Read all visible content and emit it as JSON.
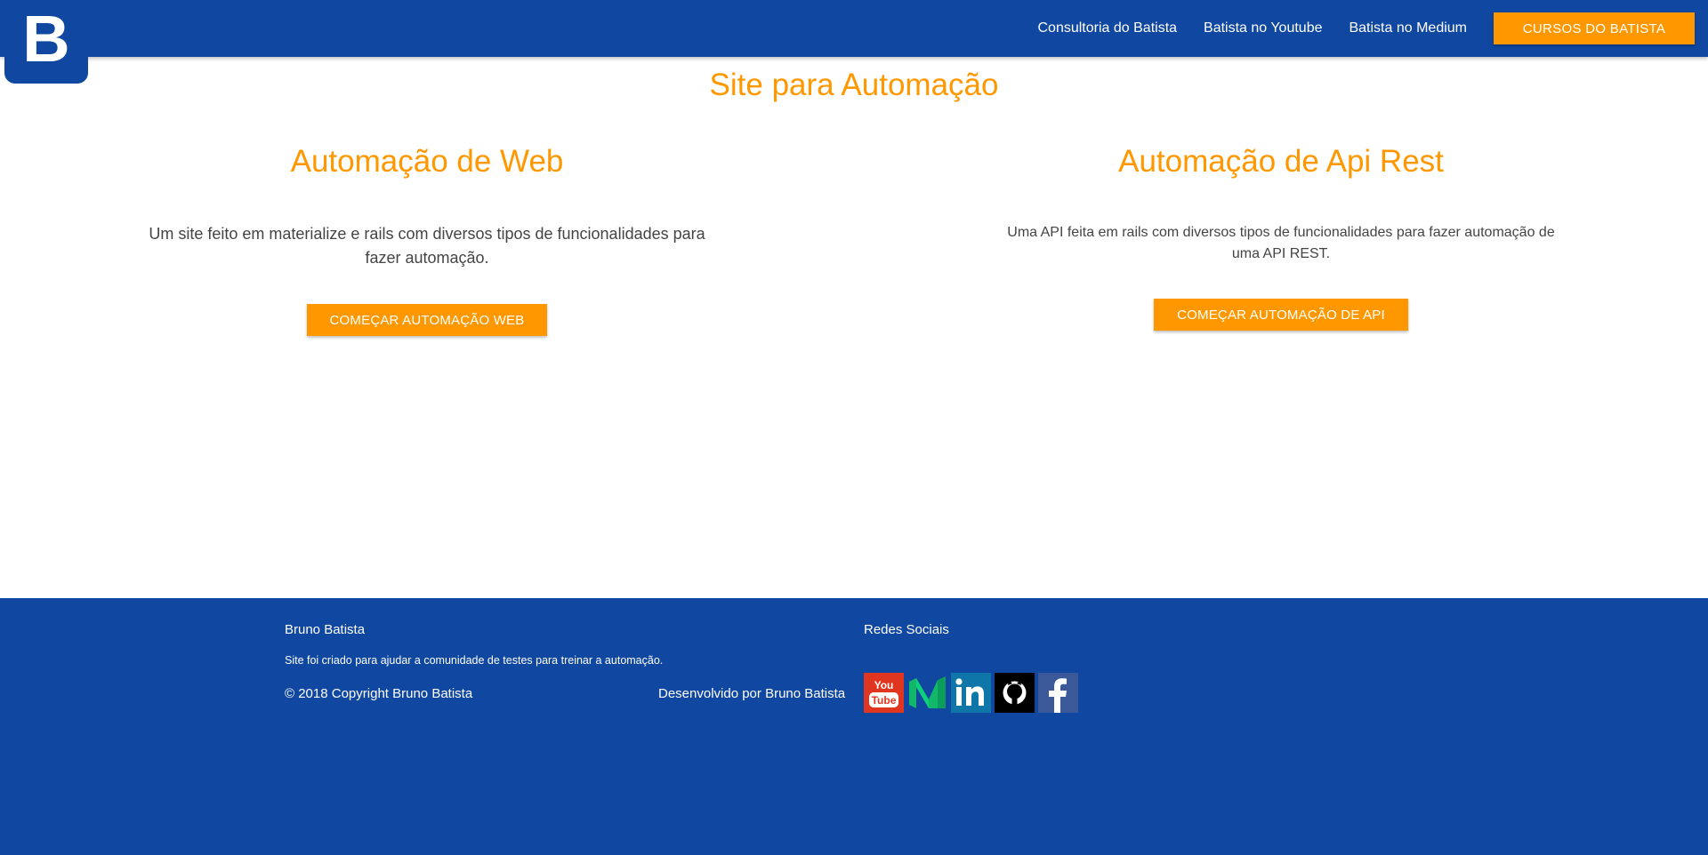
{
  "brand": {
    "logo_letter": "B"
  },
  "nav": {
    "links": [
      "Consultoria do Batista",
      "Batista no Youtube",
      "Batista no Medium"
    ],
    "cta": "CURSOS DO BATISTA"
  },
  "main": {
    "title": "Site para Automação",
    "web": {
      "heading": "Automação de Web",
      "description": "Um site feito em materialize e rails com diversos tipos de funcionalidades para fazer automação.",
      "button": "COMEÇAR AUTOMAÇÃO WEB"
    },
    "api": {
      "heading": "Automação de Api Rest",
      "description": "Uma API feita em rails com diversos tipos de funcionalidades para fazer automação de uma API REST.",
      "button": "COMEÇAR AUTOMAÇÃO DE API"
    }
  },
  "footer": {
    "name": "Bruno Batista",
    "about": "Site foi criado para ajudar a comunidade de testes para treinar a automação.",
    "copyright": "© 2018 Copyright Bruno Batista",
    "developed_by": "Desenvolvido por Bruno Batista",
    "social_title": "Redes Sociais",
    "social_icons": [
      "youtube-icon",
      "medium-icon",
      "linkedin-icon",
      "github-icon",
      "facebook-icon"
    ]
  },
  "colors": {
    "primary": "#0f47a1",
    "accent": "#ff9800"
  }
}
